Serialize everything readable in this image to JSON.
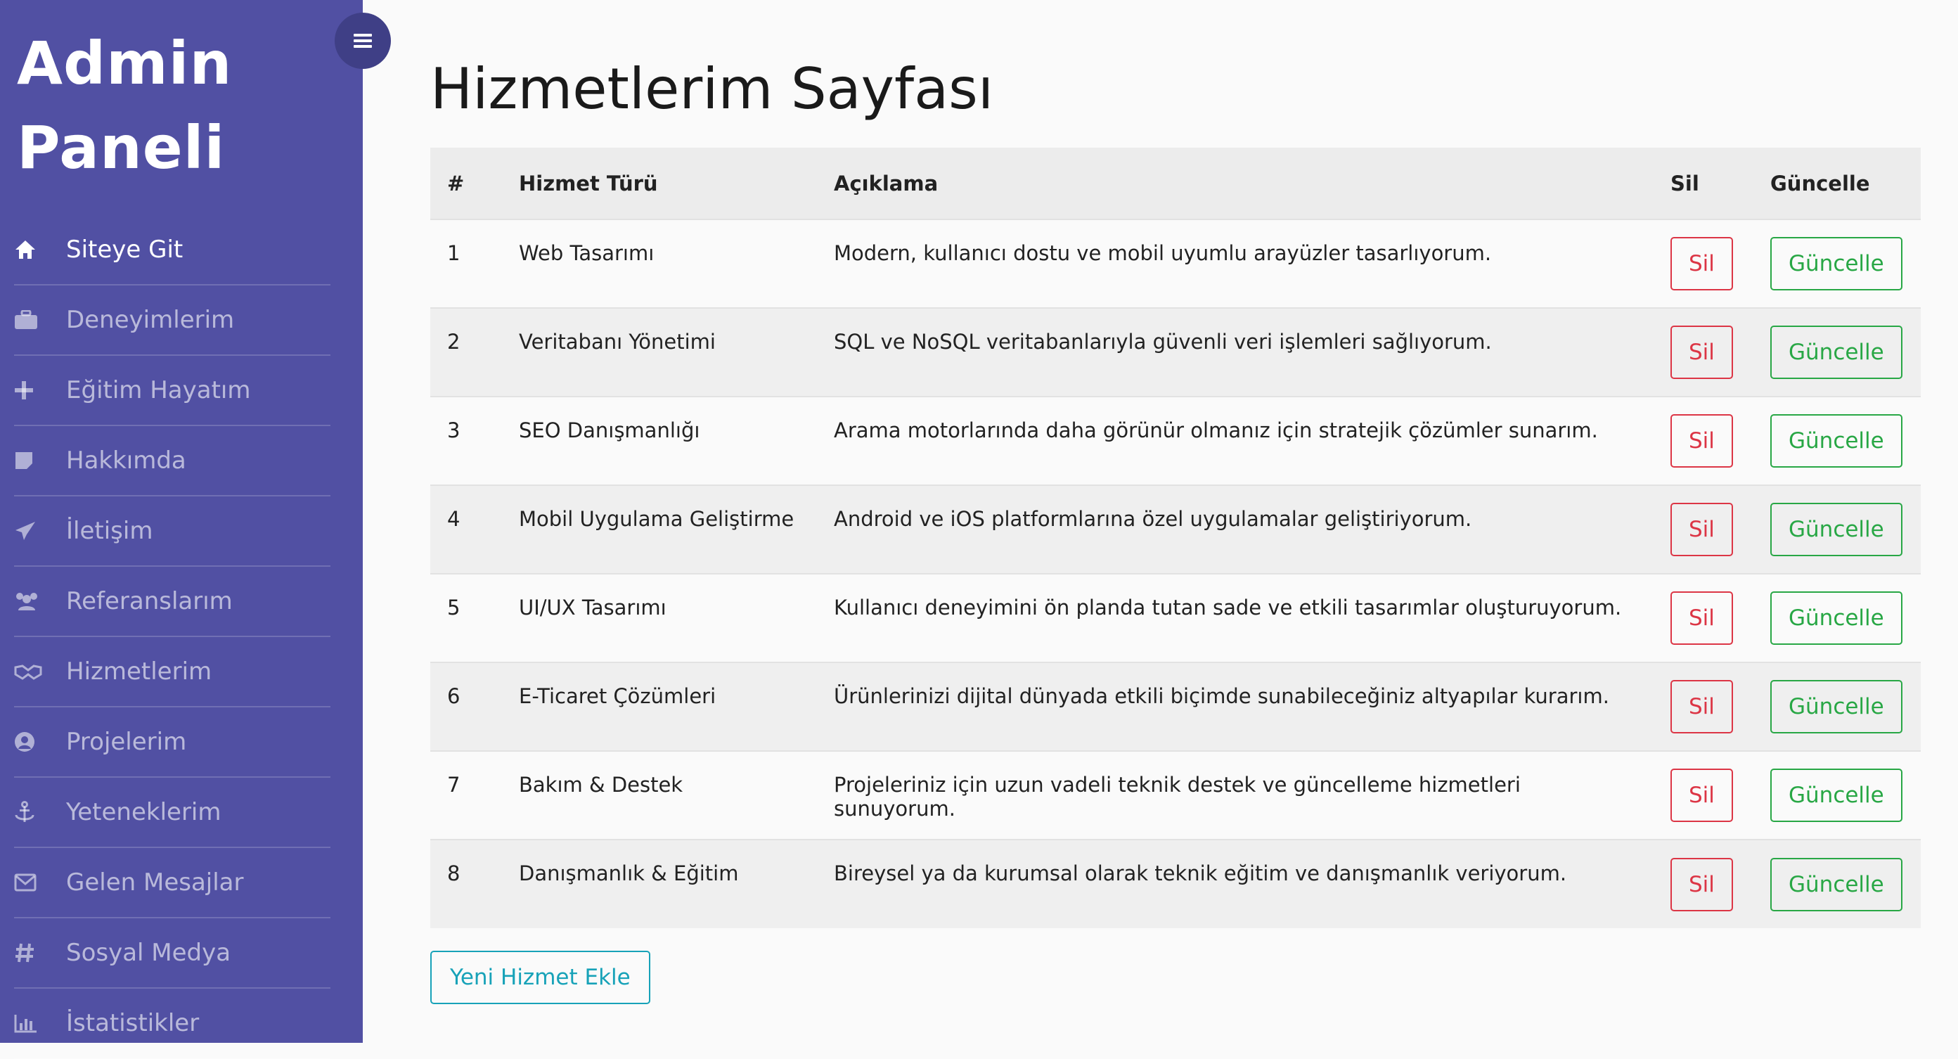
{
  "sidebar": {
    "brand": "Admin Paneli",
    "items": [
      {
        "label": "Siteye Git",
        "icon": "home-icon"
      },
      {
        "label": "Deneyimlerim",
        "icon": "briefcase-icon"
      },
      {
        "label": "Eğitim Hayatım",
        "icon": "plus-icon"
      },
      {
        "label": "Hakkımda",
        "icon": "note-icon"
      },
      {
        "label": "İletişim",
        "icon": "paper-plane-icon"
      },
      {
        "label": "Referanslarım",
        "icon": "users-icon"
      },
      {
        "label": "Hizmetlerim",
        "icon": "handshake-icon"
      },
      {
        "label": "Projelerim",
        "icon": "user-circle-icon"
      },
      {
        "label": "Yeteneklerim",
        "icon": "anchor-icon"
      },
      {
        "label": "Gelen Mesajlar",
        "icon": "envelope-icon"
      },
      {
        "label": "Sosyal Medya",
        "icon": "hashtag-icon"
      },
      {
        "label": "İstatistikler",
        "icon": "bar-chart-icon"
      }
    ]
  },
  "colors": {
    "sidebar_bg": "#5150a3",
    "toggle_bg": "#3f3f86",
    "delete": "#dc3545",
    "update": "#28a745",
    "add": "#17a2b8"
  },
  "page": {
    "title": "Hizmetlerim Sayfası",
    "add_button": "Yeni Hizmet Ekle"
  },
  "table": {
    "headers": [
      "#",
      "Hizmet Türü",
      "Açıklama",
      "Sil",
      "Güncelle"
    ],
    "rows": [
      {
        "no": "1",
        "type": "Web Tasarımı",
        "desc": "Modern, kullanıcı dostu ve mobil uyumlu arayüzler tasarlıyorum.",
        "del": "Sil",
        "upd": "Güncelle"
      },
      {
        "no": "2",
        "type": "Veritabanı Yönetimi",
        "desc": "SQL ve NoSQL veritabanlarıyla güvenli veri işlemleri sağlıyorum.",
        "del": "Sil",
        "upd": "Güncelle"
      },
      {
        "no": "3",
        "type": "SEO Danışmanlığı",
        "desc": "Arama motorlarında daha görünür olmanız için stratejik çözümler sunarım.",
        "del": "Sil",
        "upd": "Güncelle"
      },
      {
        "no": "4",
        "type": "Mobil Uygulama Geliştirme",
        "desc": "Android ve iOS platformlarına özel uygulamalar geliştiriyorum.",
        "del": "Sil",
        "upd": "Güncelle"
      },
      {
        "no": "5",
        "type": "UI/UX Tasarımı",
        "desc": "Kullanıcı deneyimini ön planda tutan sade ve etkili tasarımlar oluşturuyorum.",
        "del": "Sil",
        "upd": "Güncelle"
      },
      {
        "no": "6",
        "type": "E-Ticaret Çözümleri",
        "desc": "Ürünlerinizi dijital dünyada etkili biçimde sunabileceğiniz altyapılar kurarım.",
        "del": "Sil",
        "upd": "Güncelle"
      },
      {
        "no": "7",
        "type": "Bakım & Destek",
        "desc": "Projeleriniz için uzun vadeli teknik destek ve güncelleme hizmetleri sunuyorum.",
        "del": "Sil",
        "upd": "Güncelle"
      },
      {
        "no": "8",
        "type": "Danışmanlık & Eğitim",
        "desc": "Bireysel ya da kurumsal olarak teknik eğitim ve danışmanlık veriyorum.",
        "del": "Sil",
        "upd": "Güncelle"
      }
    ]
  }
}
